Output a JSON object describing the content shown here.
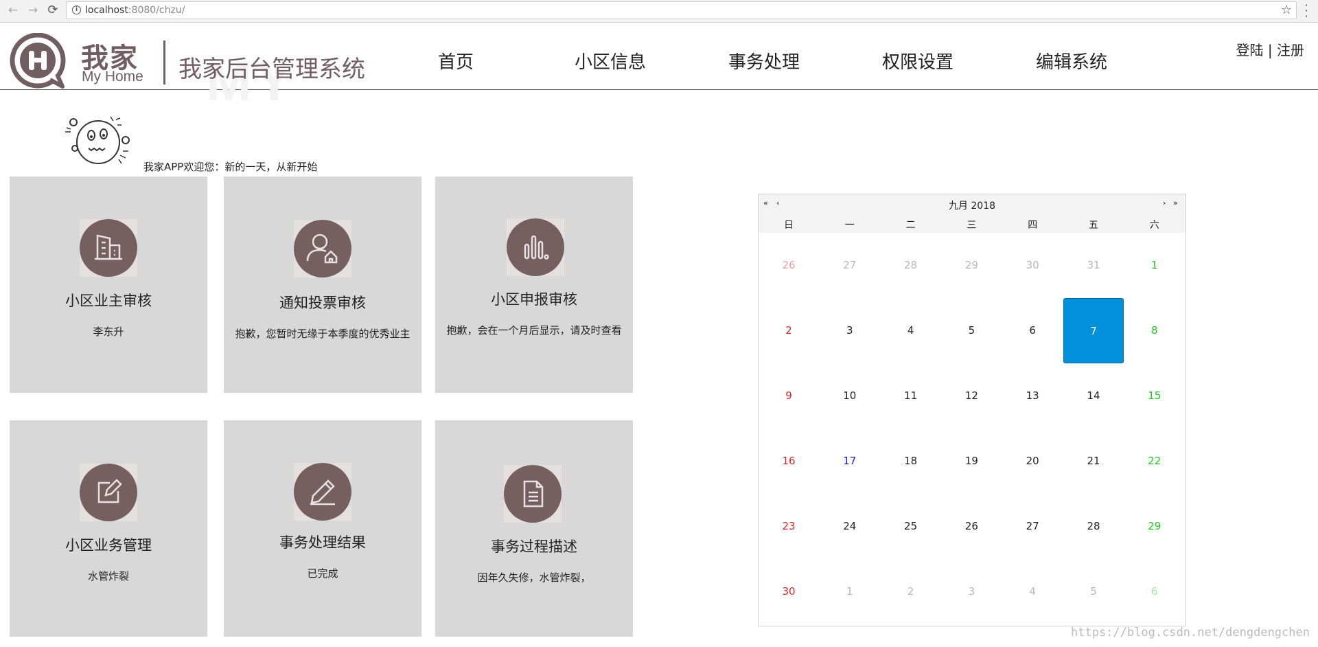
{
  "browser": {
    "back": "←",
    "forward": "→",
    "reload": "⟳",
    "url_host": "localhost",
    "url_rest": ":8080/chzu/",
    "star": "☆",
    "menu": "⋮"
  },
  "header": {
    "logo_cn": "我家",
    "logo_en": "My Home",
    "site_title": "我家后台管理系统",
    "watermark": "MY",
    "nav": [
      "首页",
      "小区信息",
      "事务处理",
      "权限设置",
      "编辑系统"
    ],
    "login": "登陆",
    "sep": "|",
    "register": "注册"
  },
  "welcome": {
    "text": "我家APP欢迎您：新的一天，从新开始"
  },
  "cards": [
    {
      "title": "小区业主审核",
      "desc": "李东升",
      "icon": "building-icon"
    },
    {
      "title": "通知投票审核",
      "desc": "抱歉，您暂时无缘于本季度的优秀业主",
      "icon": "user-home-icon"
    },
    {
      "title": "小区申报审核",
      "desc": "抱歉，会在一个月后显示，请及时查看",
      "icon": "bar-chart-icon"
    },
    {
      "title": "小区业务管理",
      "desc": "水管炸裂",
      "icon": "edit-icon"
    },
    {
      "title": "事务处理结果",
      "desc": "已完成",
      "icon": "pencil-icon"
    },
    {
      "title": "事务过程描述",
      "desc": "因年久失修，水管炸裂，",
      "icon": "document-icon"
    }
  ],
  "calendar": {
    "title": "九月 2018",
    "prev_year": "«",
    "prev_month": "‹",
    "next_month": "›",
    "next_year": "»",
    "weekdays": [
      "日",
      "一",
      "二",
      "三",
      "四",
      "五",
      "六"
    ],
    "weeks": [
      [
        "26",
        "27",
        "28",
        "29",
        "30",
        "31",
        "1"
      ],
      [
        "2",
        "3",
        "4",
        "5",
        "6",
        "7",
        "8"
      ],
      [
        "9",
        "10",
        "11",
        "12",
        "13",
        "14",
        "15"
      ],
      [
        "16",
        "17",
        "18",
        "19",
        "20",
        "21",
        "22"
      ],
      [
        "23",
        "24",
        "25",
        "26",
        "27",
        "28",
        "29"
      ],
      [
        "30",
        "1",
        "2",
        "3",
        "4",
        "5",
        "6"
      ]
    ],
    "selected": "7",
    "colors": {
      "sunday": "#d9262a",
      "saturday": "#1fc91f",
      "weekday": "#222222",
      "other_month": "#b8b8b8",
      "other_sunday": "#f0a0a0",
      "other_saturday": "#a0e8a0",
      "highlight": "#1a1ad8",
      "selected_bg": "#0290db"
    }
  },
  "footer_watermark": "https://blog.csdn.net/dengdengchen"
}
